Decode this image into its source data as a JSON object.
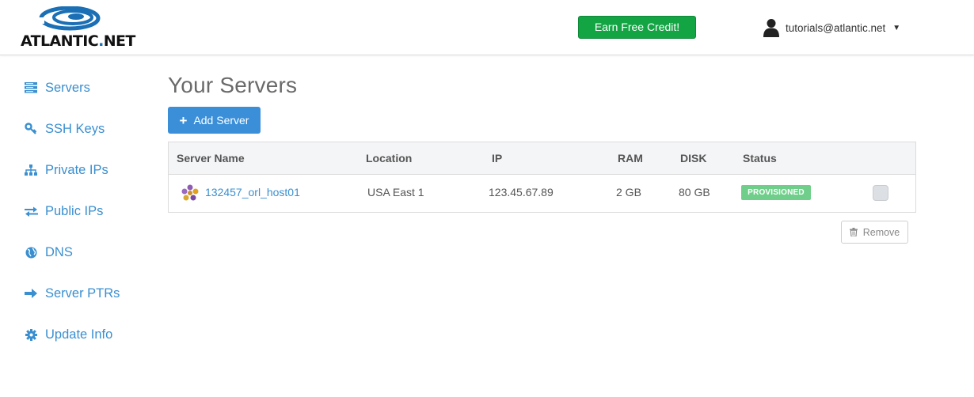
{
  "brand": {
    "logo_text_main": "ATLANTIC",
    "logo_text_dot": ".",
    "logo_text_suffix": "NET",
    "accent": "#3a8fd0"
  },
  "header": {
    "earn_label": "Earn Free Credit!",
    "user_email": "tutorials@atlantic.net",
    "caret": "▼"
  },
  "sidebar": {
    "items": [
      {
        "label": "Servers",
        "icon": "server-icon"
      },
      {
        "label": "SSH Keys",
        "icon": "key-icon"
      },
      {
        "label": "Private IPs",
        "icon": "sitemap-icon"
      },
      {
        "label": "Public IPs",
        "icon": "exchange-icon"
      },
      {
        "label": "DNS",
        "icon": "globe-icon"
      },
      {
        "label": "Server PTRs",
        "icon": "arrow-right-icon"
      },
      {
        "label": "Update Info",
        "icon": "gear-icon"
      }
    ]
  },
  "main": {
    "title": "Your Servers",
    "add_label": "Add Server",
    "add_icon": "+",
    "remove_label": "Remove",
    "table": {
      "headers": [
        "Server Name",
        "Location",
        "IP",
        "RAM",
        "DISK",
        "Status"
      ],
      "rows": [
        {
          "name": "132457_orl_host01",
          "location": "USA East 1",
          "ip": "123.45.67.89",
          "ram": "2 GB",
          "disk": "80 GB",
          "status": "PROVISIONED",
          "icon": "server-os-icon"
        }
      ]
    }
  },
  "colors": {
    "primary": "#3a8fd8",
    "success": "#13a444",
    "status_provisioned": "#6fcf8a"
  }
}
